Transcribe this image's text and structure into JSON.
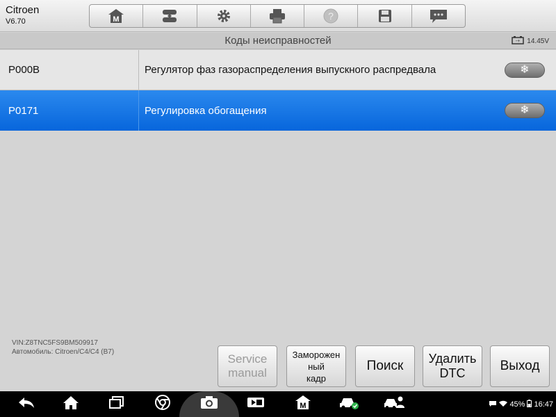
{
  "app": {
    "name": "Citroen",
    "version": "V6.70"
  },
  "toolbar": [
    {
      "icon": "home-m-icon"
    },
    {
      "icon": "vehicle-swap-icon"
    },
    {
      "icon": "gear-icon"
    },
    {
      "icon": "printer-icon"
    },
    {
      "icon": "help-icon"
    },
    {
      "icon": "save-icon"
    },
    {
      "icon": "chat-icon"
    }
  ],
  "title": "Коды неисправностей",
  "battery": {
    "icon": "battery-icon",
    "voltage": "14.45V"
  },
  "dtc_list": [
    {
      "code": "P000B",
      "description": "Регулятор фаз газораспределения выпускного распредвала",
      "freeze_icon": "❄",
      "selected": false
    },
    {
      "code": "P0171",
      "description": "Регулировка обогащения",
      "freeze_icon": "❄",
      "selected": true
    }
  ],
  "vehicle": {
    "vin": "VIN:Z8TNC5FS9BM509917",
    "model": "Автомобиль: Citroen/C4/C4 (B7)"
  },
  "buttons": {
    "service_line1": "Service",
    "service_line2": "manual",
    "freeze_line1": "Заморожен",
    "freeze_line2": "ный",
    "freeze_line3": "кадр",
    "search": "Поиск",
    "delete_line1": "Удалить",
    "delete_line2": "DTC",
    "exit": "Выход"
  },
  "statusbar": {
    "battery_percent": "45%",
    "time": "16:47"
  },
  "colors": {
    "selected_row": "#1a78e8",
    "header_bg": "#e6e6e6"
  }
}
